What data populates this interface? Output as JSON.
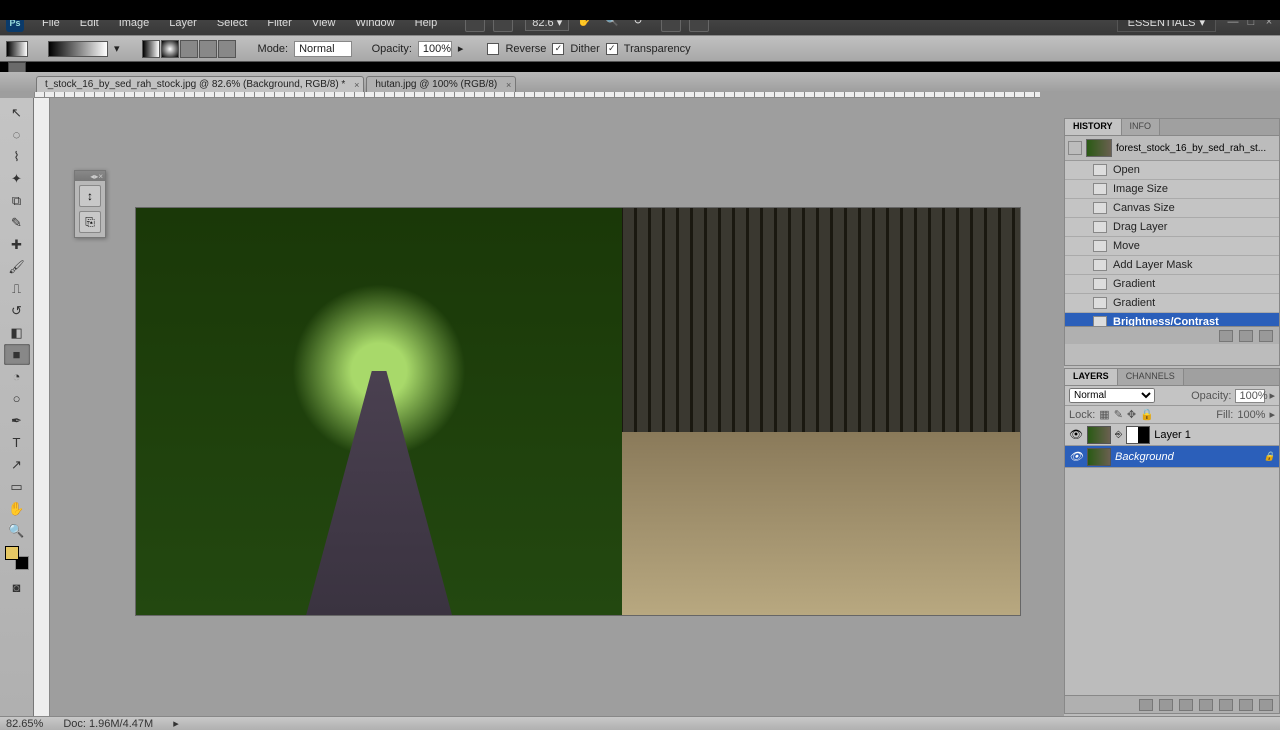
{
  "menu": {
    "items": [
      "File",
      "Edit",
      "Image",
      "Layer",
      "Select",
      "Filter",
      "View",
      "Window",
      "Help"
    ],
    "zoom": "82.6",
    "workspace": "ESSENTIALS"
  },
  "options": {
    "mode_lbl": "Mode:",
    "mode": "Normal",
    "opacity_lbl": "Opacity:",
    "opacity": "100%",
    "reverse": "Reverse",
    "dither": "Dither",
    "transparency": "Transparency"
  },
  "tabs": [
    {
      "label": "t_stock_16_by_sed_rah_stock.jpg @ 82.6% (Background, RGB/8) *",
      "active": true
    },
    {
      "label": "hutan.jpg @ 100% (RGB/8)",
      "active": false
    }
  ],
  "history": {
    "tab1": "HISTORY",
    "tab2": "INFO",
    "doc": "forest_stock_16_by_sed_rah_st...",
    "items": [
      {
        "label": "Open"
      },
      {
        "label": "Image Size"
      },
      {
        "label": "Canvas Size"
      },
      {
        "label": "Drag Layer"
      },
      {
        "label": "Move"
      },
      {
        "label": "Add Layer Mask"
      },
      {
        "label": "Gradient"
      },
      {
        "label": "Gradient"
      },
      {
        "label": "Brightness/Contrast",
        "sel": true
      }
    ]
  },
  "layers": {
    "tab1": "LAYERS",
    "tab2": "CHANNELS",
    "blend": "Normal",
    "opacity_lbl": "Opacity:",
    "opacity": "100%",
    "lock_lbl": "Lock:",
    "fill_lbl": "Fill:",
    "fill": "100%",
    "items": [
      {
        "name": "Layer 1",
        "mask": true
      },
      {
        "name": "Background",
        "sel": true,
        "locked": true
      }
    ]
  },
  "status": {
    "zoom": "82.65%",
    "doc": "Doc: 1.96M/4.47M"
  }
}
